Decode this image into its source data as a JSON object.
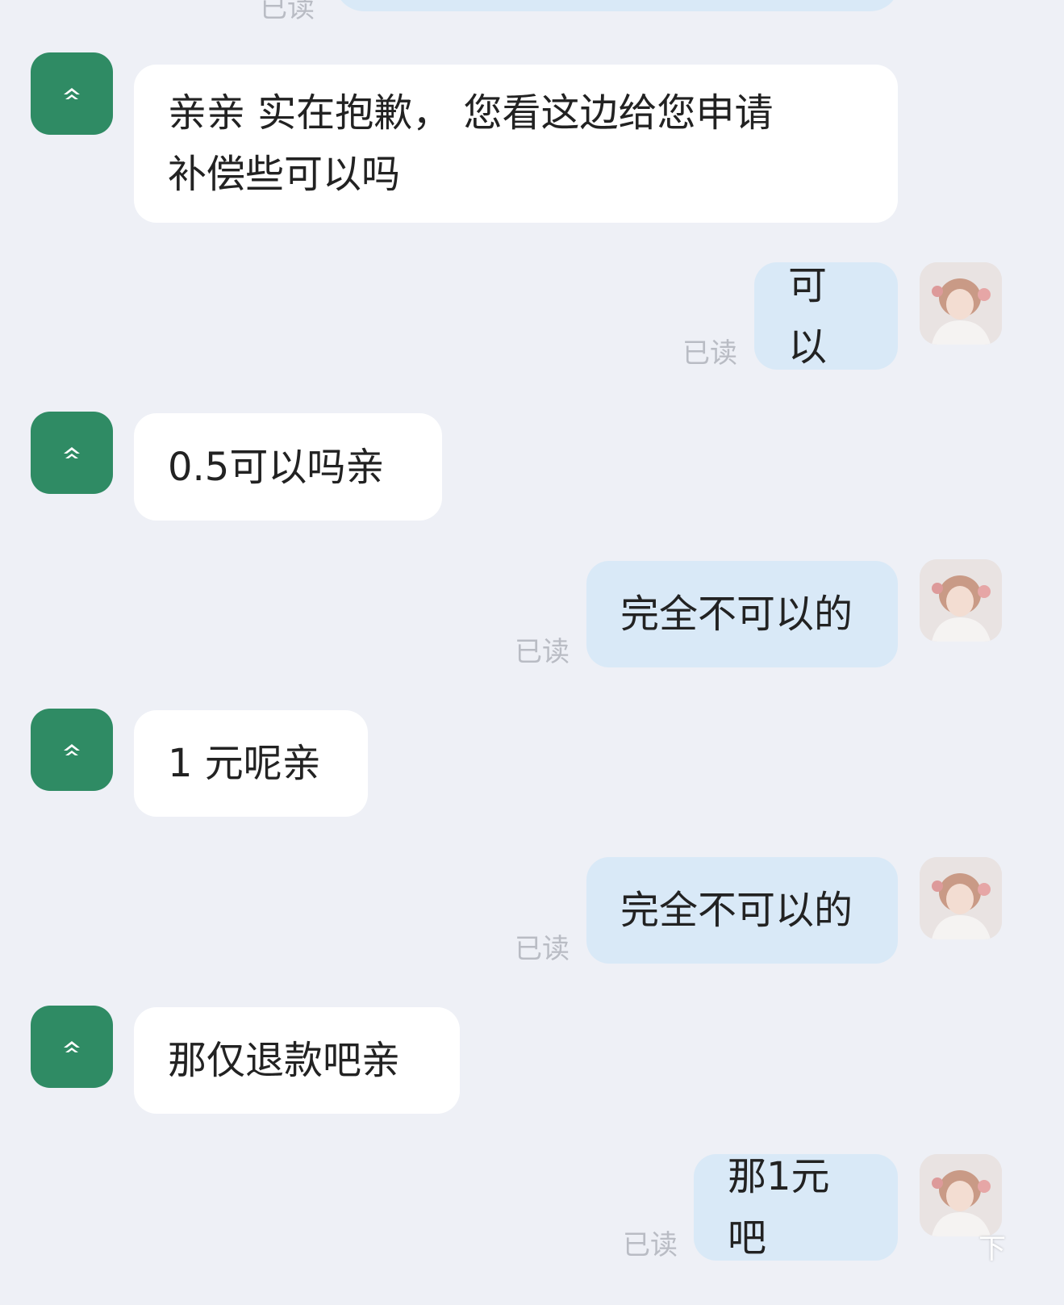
{
  "top": {
    "read_label": "已读"
  },
  "messages": [
    {
      "side": "in",
      "lines": [
        "亲亲  实在抱歉，  您看这边给您申请",
        "补偿些可以吗"
      ]
    },
    {
      "side": "out",
      "text": "可以",
      "read_label": "已读"
    },
    {
      "side": "in",
      "text": "0.5可以吗亲"
    },
    {
      "side": "out",
      "text": "完全不可以的",
      "read_label": "已读"
    },
    {
      "side": "in",
      "text": "1 元呢亲"
    },
    {
      "side": "out",
      "text": "完全不可以的",
      "read_label": "已读"
    },
    {
      "side": "in",
      "text": "那仅退款吧亲"
    },
    {
      "side": "out",
      "text": "那1元吧",
      "read_label": "已读"
    }
  ],
  "corner_mark": "下",
  "colors": {
    "background": "#eef0f6",
    "incoming_bubble": "#ffffff",
    "outgoing_bubble": "#d9e9f7",
    "shop_avatar": "#2f8b64",
    "read_text": "#b9bcc4"
  },
  "icons": {
    "shop_avatar": "shop-logo-icon",
    "user_avatar": "user-photo-avatar"
  }
}
